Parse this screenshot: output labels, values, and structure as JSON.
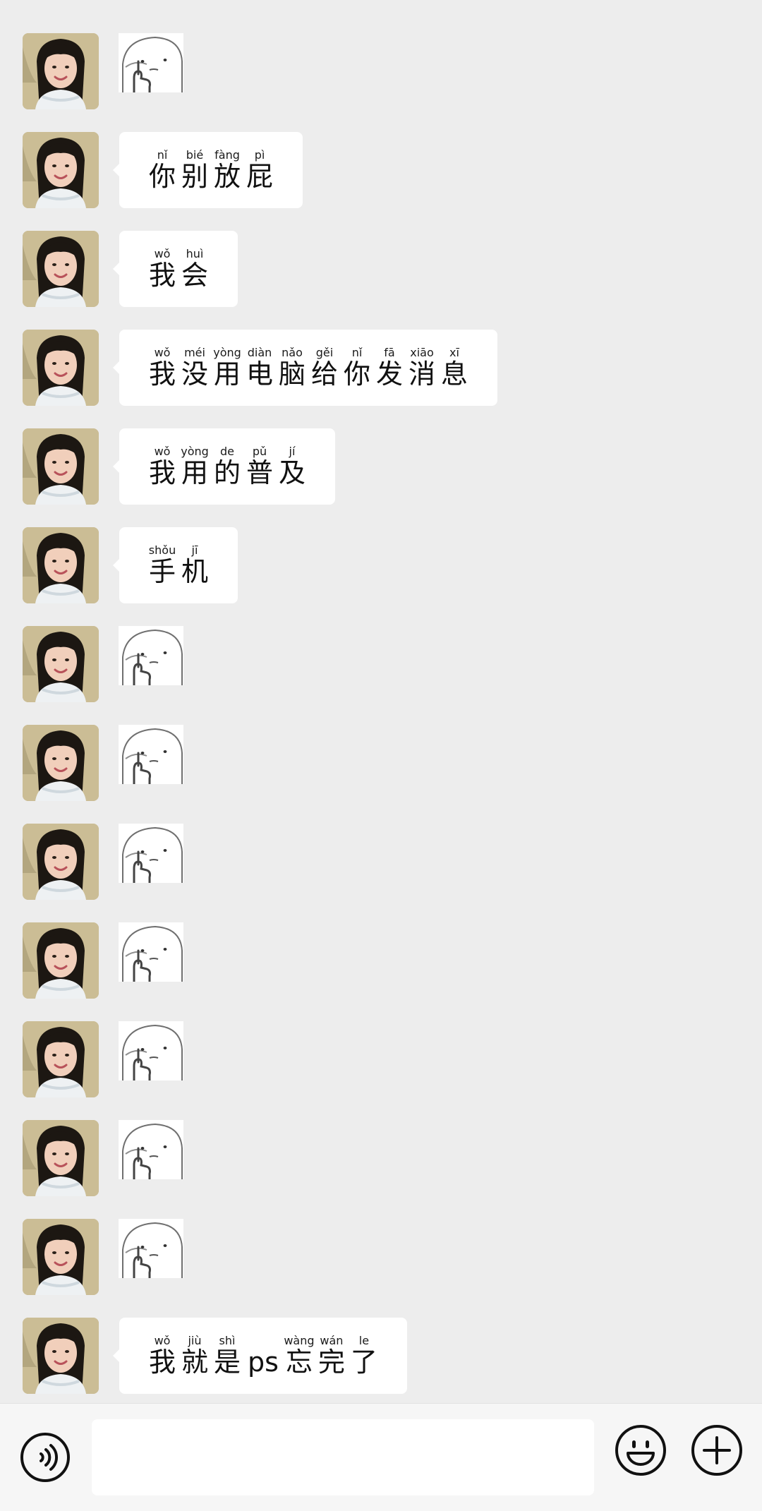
{
  "messages": [
    {
      "type": "sticker"
    },
    {
      "type": "text",
      "chars": [
        {
          "py": "nǐ",
          "hz": "你"
        },
        {
          "py": "bié",
          "hz": "别"
        },
        {
          "py": "fàng",
          "hz": "放"
        },
        {
          "py": "pì",
          "hz": "屁"
        }
      ]
    },
    {
      "type": "text",
      "chars": [
        {
          "py": "wǒ",
          "hz": "我"
        },
        {
          "py": "huì",
          "hz": "会"
        }
      ]
    },
    {
      "type": "text",
      "chars": [
        {
          "py": "wǒ",
          "hz": "我"
        },
        {
          "py": "méi",
          "hz": "没"
        },
        {
          "py": "yòng",
          "hz": "用"
        },
        {
          "py": "diàn",
          "hz": "电"
        },
        {
          "py": "nǎo",
          "hz": "脑"
        },
        {
          "py": "gěi",
          "hz": "给"
        },
        {
          "py": "nǐ",
          "hz": "你"
        },
        {
          "py": "fā",
          "hz": "发"
        },
        {
          "py": "xiāo",
          "hz": "消"
        },
        {
          "py": "xī",
          "hz": "息"
        }
      ]
    },
    {
      "type": "text",
      "chars": [
        {
          "py": "wǒ",
          "hz": "我"
        },
        {
          "py": "yòng",
          "hz": "用"
        },
        {
          "py": "de",
          "hz": "的"
        },
        {
          "py": "pǔ",
          "hz": "普"
        },
        {
          "py": "jí",
          "hz": "及"
        }
      ]
    },
    {
      "type": "text",
      "chars": [
        {
          "py": "shǒu",
          "hz": "手"
        },
        {
          "py": "jī",
          "hz": "机"
        }
      ]
    },
    {
      "type": "sticker"
    },
    {
      "type": "sticker"
    },
    {
      "type": "sticker"
    },
    {
      "type": "sticker"
    },
    {
      "type": "sticker"
    },
    {
      "type": "sticker"
    },
    {
      "type": "sticker"
    },
    {
      "type": "text",
      "chars": [
        {
          "py": "wǒ",
          "hz": "我"
        },
        {
          "py": "jiù",
          "hz": "就"
        },
        {
          "py": "shì",
          "hz": "是"
        },
        {
          "py": "",
          "hz": "ps",
          "latin": true
        },
        {
          "py": "wàng",
          "hz": "忘"
        },
        {
          "py": "wán",
          "hz": "完"
        },
        {
          "py": "le",
          "hz": "了"
        }
      ]
    }
  ],
  "input_bar": {
    "voice_icon": "voice-icon",
    "emoji_icon": "emoji-icon",
    "plus_icon": "plus-icon",
    "input_value": ""
  },
  "colors": {
    "background": "#ededed",
    "bubble": "#ffffff",
    "bar": "#f6f6f6"
  }
}
